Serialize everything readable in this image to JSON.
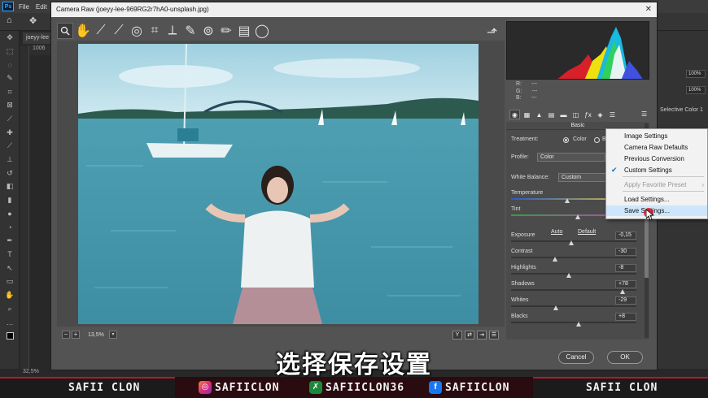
{
  "photoshop": {
    "menu": [
      "File",
      "Edit"
    ],
    "logo": "Ps",
    "document_tab": "joeyy-lee",
    "ruler_value": "1006",
    "zoom_status": "32,5%",
    "right_dock": {
      "zoom_a": "100%",
      "zoom_b": "100%",
      "layer_label": "Selective Color 1"
    }
  },
  "camera_raw": {
    "title": "Camera Raw (joeyy-lee-969RG2r7hA0-unsplash.jpg)",
    "zoom_value": "13,5%",
    "rgb_readout": {
      "r_label": "R:",
      "g_label": "G:",
      "b_label": "B:",
      "r": "---",
      "g": "---",
      "b": "---"
    },
    "panel_title": "Basic",
    "treatment": {
      "label": "Treatment:",
      "option_color": "Color",
      "option_bw": "Bl"
    },
    "profile": {
      "label": "Profile:",
      "value": "Color"
    },
    "white_balance": {
      "label": "White Balance:",
      "value": "Custom"
    },
    "links": {
      "auto": "Auto",
      "default": "Default"
    },
    "sliders": [
      {
        "name": "Temperature",
        "value": "",
        "position": 0.45
      },
      {
        "name": "Tint",
        "value": "",
        "position": 0.53
      },
      {
        "name": "Exposure",
        "value": "-0,15",
        "position": 0.48
      },
      {
        "name": "Contrast",
        "value": "-30",
        "position": 0.35
      },
      {
        "name": "Highlights",
        "value": "-8",
        "position": 0.46
      },
      {
        "name": "Shadows",
        "value": "+78",
        "position": 0.89
      },
      {
        "name": "Whites",
        "value": "-29",
        "position": 0.36
      },
      {
        "name": "Blacks",
        "value": "+8",
        "position": 0.54
      }
    ],
    "buttons": {
      "cancel": "Cancel",
      "ok": "OK"
    }
  },
  "context_menu": {
    "items": [
      {
        "label": "Image Settings",
        "state": "normal",
        "checked": false
      },
      {
        "label": "Camera Raw Defaults",
        "state": "normal",
        "checked": false
      },
      {
        "label": "Previous Conversion",
        "state": "normal",
        "checked": false
      },
      {
        "label": "Custom Settings",
        "state": "normal",
        "checked": true
      },
      {
        "label": "Apply Favorite Preset",
        "state": "disabled",
        "checked": false,
        "submenu": true
      },
      {
        "label": "Load Settings...",
        "state": "normal",
        "checked": false
      },
      {
        "label": "Save Settings...",
        "state": "highlighted",
        "checked": false
      }
    ]
  },
  "subtitle": "选择保存设置",
  "banner": {
    "left": "SAFII CLON",
    "instagram": "SAFIICLON",
    "other": "SAFIICLON36",
    "facebook": "SAFIICLON",
    "right": "SAFII CLON"
  },
  "colors": {
    "highlight": "#cde6fb",
    "check": "#1a6fd1",
    "banner_red": "#c8102e"
  }
}
